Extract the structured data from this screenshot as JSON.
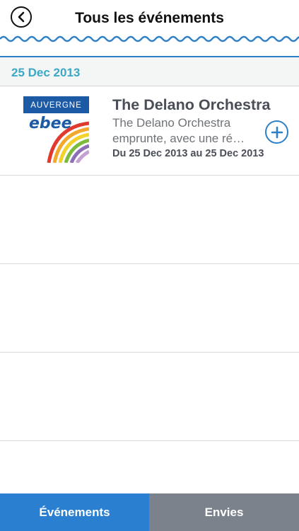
{
  "header": {
    "title": "Tous les événements",
    "back_icon": "chevron-left-icon"
  },
  "colors": {
    "accent": "#2d7fc6",
    "date_text": "#3aa8c6",
    "tab_active": "#2a7fd0",
    "tab_inactive": "#7b828c"
  },
  "date_section": {
    "label": "25 Dec 2013"
  },
  "events": [
    {
      "thumbnail": {
        "banner": "AUVERGNE",
        "logo": "ebee"
      },
      "title": "The Delano Orchestra",
      "description": "The Delano Orchestra emprunte, avec une ré…",
      "dates": "Du 25 Dec 2013 au 25 Dec 2013",
      "add_icon": "plus-circle-icon"
    }
  ],
  "tabs": [
    {
      "label": "Événements",
      "active": true
    },
    {
      "label": "Envies",
      "active": false
    }
  ]
}
